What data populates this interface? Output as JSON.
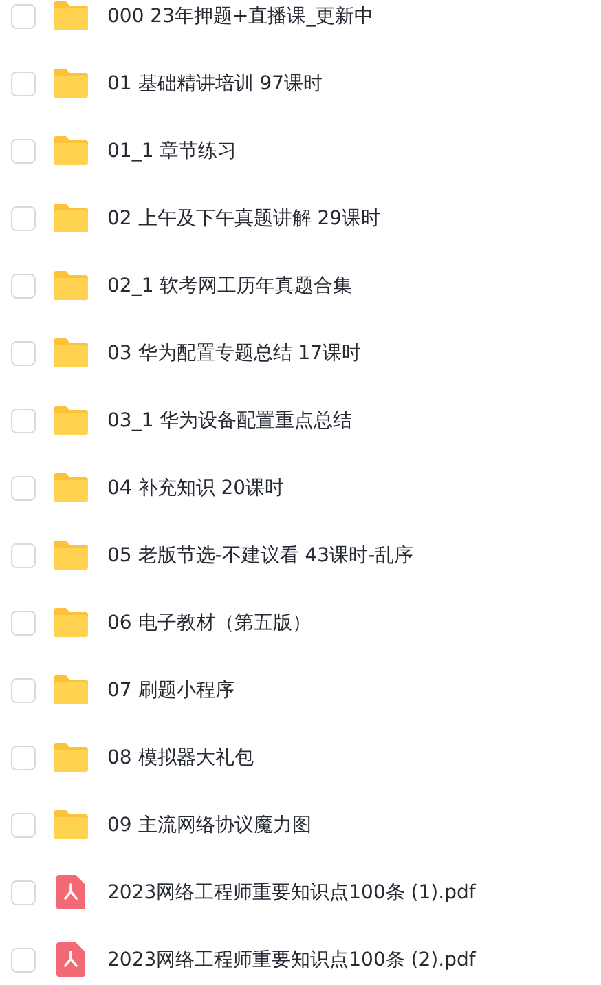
{
  "files": [
    {
      "kind": "folder",
      "name": "000 23年押题+直播课_更新中",
      "checked": false
    },
    {
      "kind": "folder",
      "name": "01 基础精讲培训 97课时",
      "checked": false
    },
    {
      "kind": "folder",
      "name": "01_1 章节练习",
      "checked": false
    },
    {
      "kind": "folder",
      "name": "02 上午及下午真题讲解 29课时",
      "checked": false
    },
    {
      "kind": "folder",
      "name": "02_1 软考网工历年真题合集",
      "checked": false
    },
    {
      "kind": "folder",
      "name": "03 华为配置专题总结 17课时",
      "checked": false
    },
    {
      "kind": "folder",
      "name": "03_1 华为设备配置重点总结",
      "checked": false
    },
    {
      "kind": "folder",
      "name": "04 补充知识 20课时",
      "checked": false
    },
    {
      "kind": "folder",
      "name": "05 老版节选-不建议看 43课时-乱序",
      "checked": false
    },
    {
      "kind": "folder",
      "name": "06 电子教材（第五版）",
      "checked": false
    },
    {
      "kind": "folder",
      "name": "07 刷题小程序",
      "checked": false
    },
    {
      "kind": "folder",
      "name": "08 模拟器大礼包",
      "checked": false
    },
    {
      "kind": "folder",
      "name": "09 主流网络协议魔力图",
      "checked": false
    },
    {
      "kind": "pdf",
      "name": "2023网络工程师重要知识点100条 (1).pdf",
      "checked": false
    },
    {
      "kind": "pdf",
      "name": "2023网络工程师重要知识点100条 (2).pdf",
      "checked": false
    }
  ]
}
